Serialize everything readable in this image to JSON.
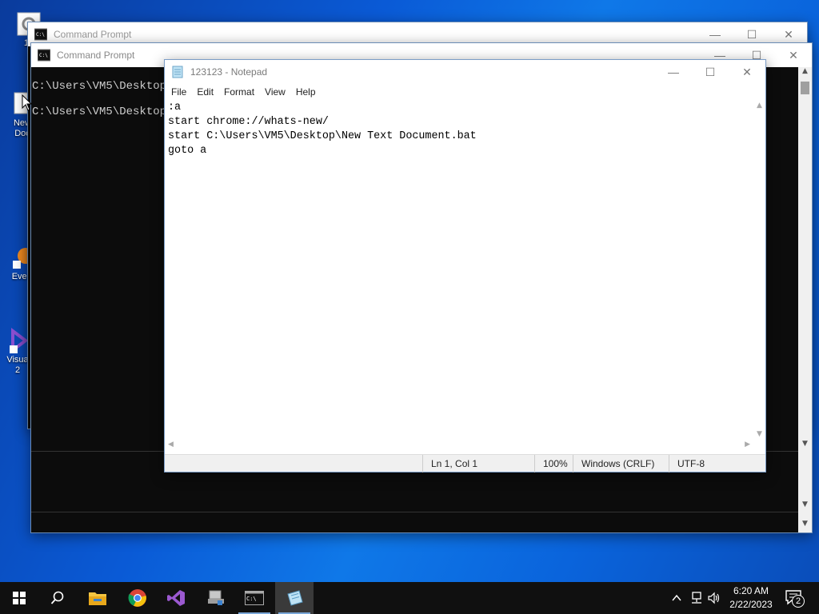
{
  "desktop": {
    "icons": [
      {
        "label": "12",
        "icon": "gear-icon"
      },
      {
        "label": "New\nDoc",
        "icon": "text-file-icon"
      },
      {
        "label": "Ever",
        "icon": "everything-icon"
      },
      {
        "label": "Visua\n2",
        "icon": "visual-studio-icon"
      }
    ]
  },
  "cmd_back": {
    "title": "Command Prompt",
    "controls": {
      "minimize": "—",
      "maximize": "☐",
      "close": "✕"
    }
  },
  "cmd_front": {
    "title": "Command Prompt",
    "lines": [
      "C:\\Users\\VM5\\Desktop>",
      "C:\\Users\\VM5\\Desktop>"
    ],
    "controls": {
      "minimize": "—",
      "maximize": "☐",
      "close": "✕"
    }
  },
  "notepad": {
    "title": "123123 - Notepad",
    "menu": [
      "File",
      "Edit",
      "Format",
      "View",
      "Help"
    ],
    "content": ":a\nstart chrome://whats-new/\nstart C:\\Users\\VM5\\Desktop\\New Text Document.bat\ngoto a",
    "status": {
      "position": "Ln 1, Col 1",
      "zoom": "100%",
      "line_ending": "Windows (CRLF)",
      "encoding": "UTF-8"
    },
    "controls": {
      "minimize": "—",
      "maximize": "☐",
      "close": "✕"
    }
  },
  "taskbar": {
    "apps": [
      "start-icon",
      "search-icon",
      "file-explorer-icon",
      "chrome-icon",
      "visual-studio-icon",
      "network-app-icon",
      "command-prompt-icon",
      "notepad-icon"
    ],
    "clock": {
      "time": "6:20 AM",
      "date": "2/22/2023"
    },
    "notifications_count": "2"
  },
  "colors": {
    "accent": "#0a64dc",
    "taskbar": "#101010",
    "console_bg": "#0c0c0c",
    "console_fg": "#cccccc"
  }
}
